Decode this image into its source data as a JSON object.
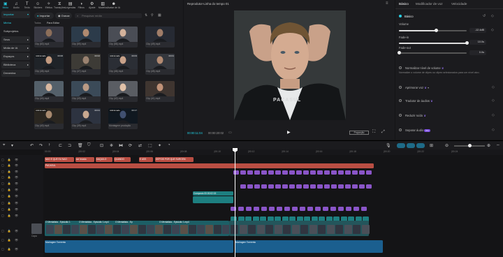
{
  "toolbar": {
    "items": [
      {
        "icon": "media-icon",
        "label": "Mídia",
        "active": true
      },
      {
        "icon": "audio-icon",
        "label": "Áudio"
      },
      {
        "icon": "text-icon",
        "label": "Texto"
      },
      {
        "icon": "stickers-icon",
        "label": "Stickers"
      },
      {
        "icon": "effects-icon",
        "label": "Efeitos"
      },
      {
        "icon": "transitions-icon",
        "label": "Transições"
      },
      {
        "icon": "captions-icon",
        "label": "Legendas"
      },
      {
        "icon": "filters-icon",
        "label": "Filtros"
      },
      {
        "icon": "adjust-icon",
        "label": "Ajuste"
      },
      {
        "icon": "templates-icon",
        "label": "Modelos"
      },
      {
        "icon": "ai-avatar-icon",
        "label": "Avatar de IA"
      }
    ]
  },
  "leftnav": {
    "items": [
      {
        "label": "Importar",
        "box": true,
        "active": true,
        "arrow": "▾"
      },
      {
        "label": "Minha",
        "box": false,
        "active": true,
        "arrow": ""
      },
      {
        "label": "Subprojetos",
        "box": false,
        "active": false,
        "arrow": ""
      },
      {
        "label": "Seus",
        "box": true,
        "active": false,
        "arrow": "▸"
      },
      {
        "label": "Mídia de IA",
        "box": true,
        "active": false,
        "arrow": "▸"
      },
      {
        "label": "Espaços",
        "box": true,
        "active": false,
        "arrow": "▸"
      },
      {
        "label": "Biblioteca",
        "box": true,
        "active": false,
        "arrow": "▸"
      },
      {
        "label": "Dreamina",
        "box": true,
        "active": false,
        "arrow": ""
      }
    ]
  },
  "media": {
    "import_label": "Importar",
    "record_label": "Gravar",
    "search_placeholder": "Pesquisar mídia",
    "subtabs": [
      "Todos",
      "Para Editar"
    ],
    "tiles": [
      {
        "name": "Clip (60).mp4",
        "badge": "",
        "dur": ""
      },
      {
        "name": "Clip (59).mp4",
        "badge": "",
        "dur": ""
      },
      {
        "name": "Clip (58).mp4",
        "badge": "",
        "dur": ""
      },
      {
        "name": "Clip (49).mp4",
        "badge": "",
        "dur": ""
      },
      {
        "name": "Clip (48).mp4",
        "badge": "Adicionado",
        "dur": "00:06"
      },
      {
        "name": "Clip (47).mp4",
        "badge": "",
        "dur": "00:02"
      },
      {
        "name": "Clip (46).mp4",
        "badge": "Adicionado",
        "dur": "00:03"
      },
      {
        "name": "Clip (45).mp4",
        "badge": "",
        "dur": "00:01"
      },
      {
        "name": "Clip (44).mp4",
        "badge": "",
        "dur": ""
      },
      {
        "name": "Clip (43).mp4",
        "badge": "",
        "dur": ""
      },
      {
        "name": "Clip (42).mp4",
        "badge": "",
        "dur": ""
      },
      {
        "name": "Clip (41).mp4",
        "badge": "",
        "dur": ""
      },
      {
        "name": "Clip (40).mp4",
        "badge": "Adicionado",
        "dur": ""
      },
      {
        "name": "Clip (39).mp4",
        "badge": "",
        "dur": "00:01"
      },
      {
        "name": "Montagem produção",
        "badge": "Adicionado",
        "dur": "00:17"
      }
    ]
  },
  "player": {
    "title": "Reprodutor-Linha do tempo 01",
    "timecode_current": "00:00:11:04",
    "timecode_total": "00:00:20:02",
    "ratio_label": "Proporção",
    "watermark": "PACASUL"
  },
  "inspector": {
    "tabs": [
      "Básico",
      "Modificador de voz",
      "Velocidade"
    ],
    "section": "Básico",
    "volume_label": "Volume",
    "volume_value": "-12.4dB",
    "volume_level": 0.55,
    "fadein_label": "Fade-in",
    "fadein_value": "10.0s",
    "fadein_level": 1.0,
    "fadeout_label": "Fade-out",
    "fadeout_value": "0.0s",
    "fadeout_level": 0.0,
    "normalize_label": "Normalizar nível de volume",
    "normalize_desc": "Normalize o volume de clipes ou clipes selecionados para um nível alvo.",
    "enhance_label": "Aprimorar voz",
    "translate_label": "Tradutor de áudios",
    "noise_label": "Reduzir ruído",
    "separate_label": "Separar áudio",
    "pro_label": "Pro"
  },
  "timeline": {
    "ticks": [
      "00:00",
      "|00:02",
      "|00:04",
      "|00:06",
      "|00:08",
      "|00:10",
      "|00:12",
      "|00:14",
      "|00:16",
      "|00:18",
      "|00:20",
      "|00:22",
      "|00:24"
    ],
    "caption_clips": [
      "NAO E QUE EU NAO",
      "ser levado",
      "DAQUILO",
      "QUANDO",
      "E ASS",
      "DEPOIS POR QUE SURGEM"
    ],
    "title_clip": "PACASUL",
    "compound_clip": "Composto 00:00:02:15",
    "main_clips": [
      "O Mentalista - Episódio 1",
      "O Mentalista - Episódio 1.mp4",
      "O Mentalista - Ep",
      "O Mentalista - Episódio 1.mp4"
    ],
    "audio_clip_1": "Montagem Tormento",
    "audio_clip_2": "Montagem Tormento",
    "cover_label": "Capa"
  }
}
